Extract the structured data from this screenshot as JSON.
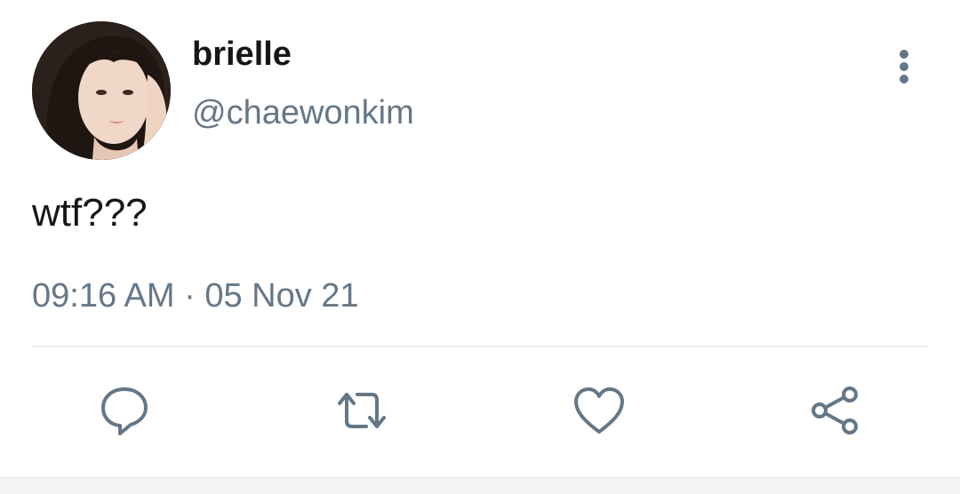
{
  "tweet": {
    "author": {
      "display_name": "brielle",
      "handle": "@chaewonkim",
      "avatar_icon": "profile-photo"
    },
    "text": "wtf???",
    "timestamp": "09:16 AM · 05 Nov 21",
    "actions": [
      {
        "name": "reply",
        "icon": "speech-bubble-icon"
      },
      {
        "name": "retweet",
        "icon": "retweet-arrows-icon"
      },
      {
        "name": "like",
        "icon": "heart-icon"
      },
      {
        "name": "share",
        "icon": "share-nodes-icon"
      }
    ],
    "menu_icon": "vertical-ellipsis-icon"
  },
  "colors": {
    "text_primary": "#14171a",
    "text_secondary": "#657786",
    "icon": "#657786",
    "divider": "#e6ecf0",
    "background": "#ffffff"
  }
}
